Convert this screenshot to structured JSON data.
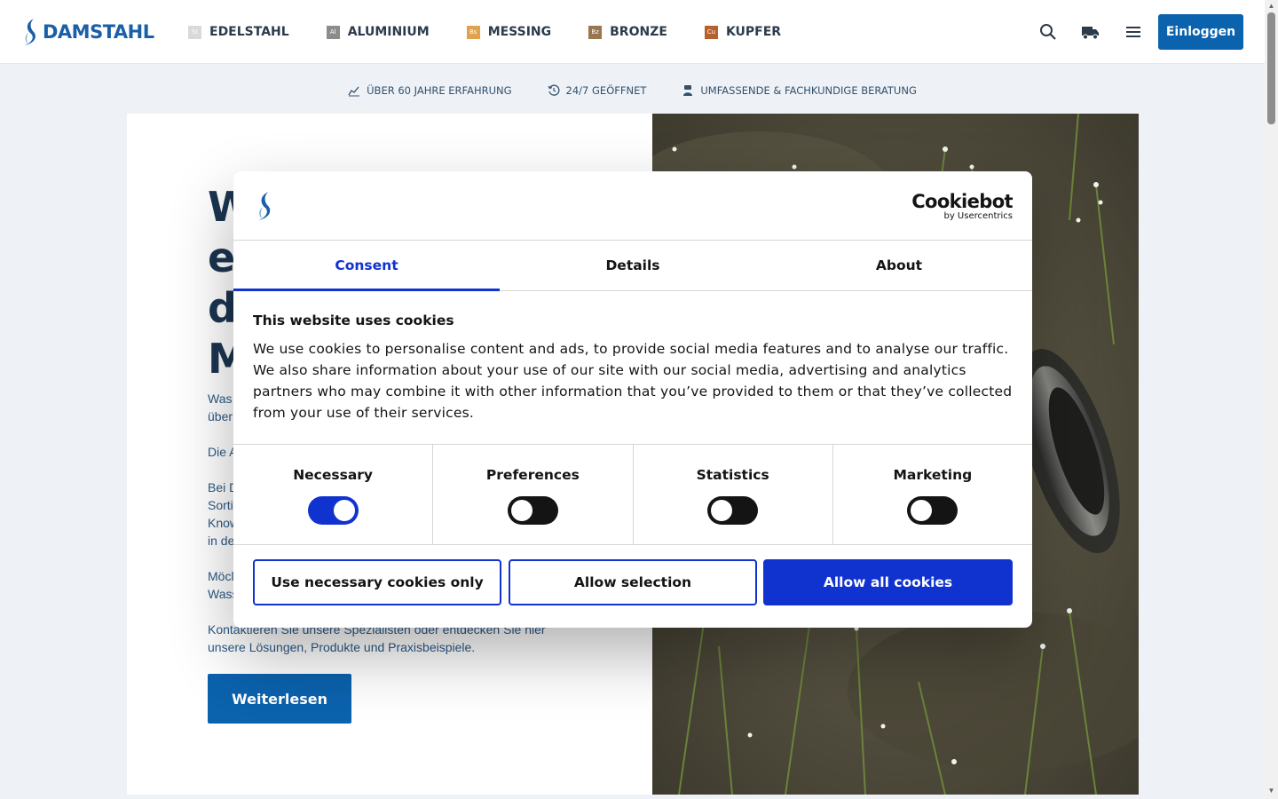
{
  "brand": {
    "name": "DAMSTAHL",
    "color": "#1a5fa8"
  },
  "nav": [
    {
      "badge": "St",
      "label": "EDELSTAHL",
      "color": "#d9d9d9"
    },
    {
      "badge": "Al",
      "label": "ALUMINIUM",
      "color": "#8c8c8c"
    },
    {
      "badge": "Bs",
      "label": "MESSING",
      "color": "#e0a24a"
    },
    {
      "badge": "Bz",
      "label": "BRONZE",
      "color": "#9a7650"
    },
    {
      "badge": "Cu",
      "label": "KUPFER",
      "color": "#b5602f"
    }
  ],
  "header_icons": [
    "search-icon",
    "truck-icon",
    "menu-icon"
  ],
  "login_label": "Einloggen",
  "usp": [
    {
      "icon": "chart-icon",
      "label": "ÜBER 60 JAHRE ERFAHRUNG"
    },
    {
      "icon": "clock-icon",
      "label": "24/7 GEÖFFNET"
    },
    {
      "icon": "advisor-icon",
      "label": "UMFASSENDE & FACHKUNDIGE BERATUNG"
    }
  ],
  "hero": {
    "title_lines": [
      "W",
      "e",
      "d",
      "M"
    ],
    "paragraphs": [
      "Was",
      "über",
      "Die A",
      "Bei D",
      "Sorti",
      "Know",
      "in de",
      "Möcl",
      "Wass",
      "Kontaktieren Sie unsere Spezialisten oder entdecken Sie hier",
      "unsere Lösungen, Produkte und Praxisbeispiele."
    ],
    "read_more": "Weiterlesen"
  },
  "cookie": {
    "provider": "Cookiebot",
    "provider_sub": "by Usercentrics",
    "tabs": [
      "Consent",
      "Details",
      "About"
    ],
    "active_tab": "Consent",
    "title": "This website uses cookies",
    "description": "We use cookies to personalise content and ads, to provide social media features and to analyse our traffic. We also share information about your use of our site with our social media, advertising and analytics partners who may combine it with other information that you’ve provided to them or that they’ve collected from your use of their services.",
    "categories": [
      {
        "label": "Necessary",
        "enabled": true
      },
      {
        "label": "Preferences",
        "enabled": false
      },
      {
        "label": "Statistics",
        "enabled": false
      },
      {
        "label": "Marketing",
        "enabled": false
      }
    ],
    "buttons": {
      "necessary_only": "Use necessary cookies only",
      "allow_selection": "Allow selection",
      "allow_all": "Allow all cookies"
    },
    "accent": "#1032cf"
  }
}
